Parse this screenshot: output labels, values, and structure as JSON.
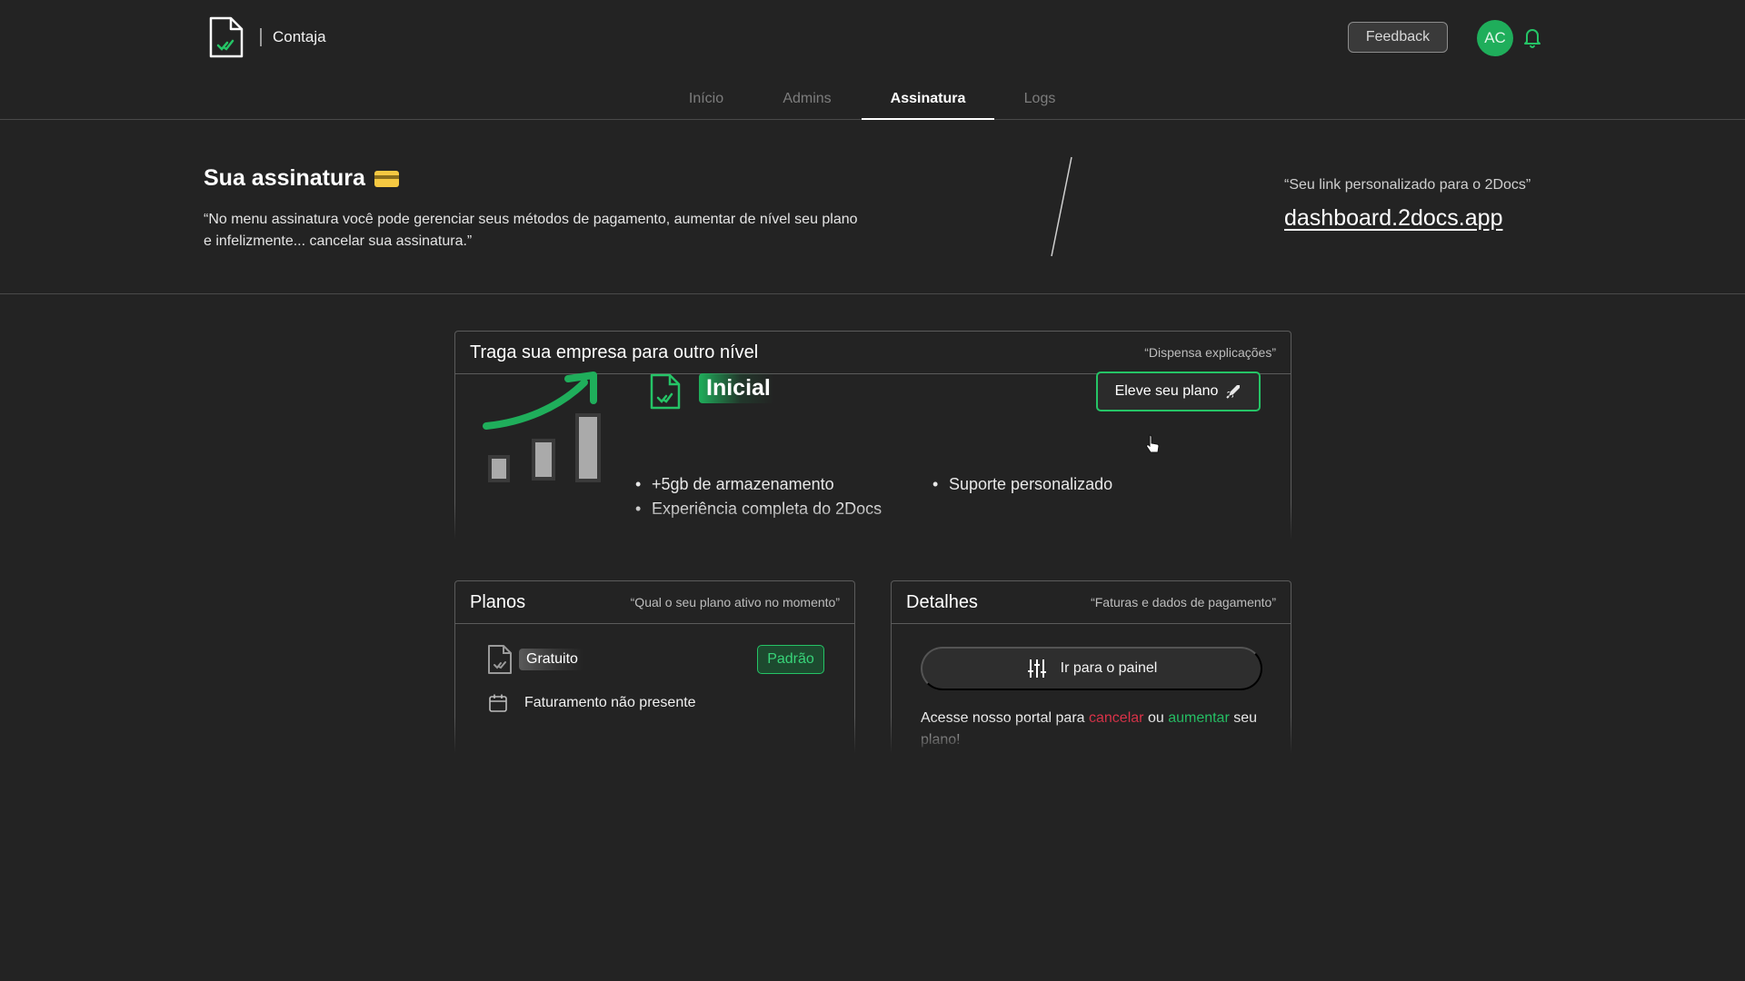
{
  "header": {
    "brand": "Contaja",
    "feedback_label": "Feedback",
    "avatar_initials": "AC",
    "icons": {
      "logo": "document-check-icon",
      "bell": "bell-icon"
    }
  },
  "tabs": [
    {
      "label": "Início",
      "active": false
    },
    {
      "label": "Admins",
      "active": false
    },
    {
      "label": "Assinatura",
      "active": true
    },
    {
      "label": "Logs",
      "active": false
    }
  ],
  "hero": {
    "title": "Sua assinatura",
    "title_icon": "credit-card-icon",
    "description": "“No menu assinatura você pode gerenciar seus métodos de pagamento, aumentar de nível seu plano e infelizmente... cancelar sua assinatura.”",
    "link_label": "“Seu link personalizado para o 2Docs”",
    "link_text": "dashboard.2docs.app"
  },
  "upgrade_card": {
    "title": "Traga sua empresa para outro nível",
    "subtitle": "“Dispensa explicações”",
    "plan_name": "Inicial",
    "upgrade_button": "Eleve seu plano",
    "upgrade_icon": "rocket-icon",
    "features": [
      "+5gb de armazenamento",
      "Experiência completa do 2Docs",
      "Suporte personalizado"
    ]
  },
  "plans_card": {
    "title": "Planos",
    "subtitle": "“Qual o seu plano ativo no momento”",
    "current_plan": "Gratuito",
    "badge": "Padrão",
    "billing": "Faturamento não presente"
  },
  "details_card": {
    "title": "Detalhes",
    "subtitle": "“Faturas e dados de pagamento”",
    "panel_button": "Ir para o painel",
    "portal_prefix": "Acesse nosso portal para",
    "portal_cancel": "cancelar",
    "portal_or": "ou",
    "portal_increase": "aumentar",
    "portal_suffix": "seu plano!"
  },
  "colors": {
    "background": "#232323",
    "accent_green": "#25c466",
    "danger_red": "#e0334a",
    "border": "#5b5b5b"
  }
}
